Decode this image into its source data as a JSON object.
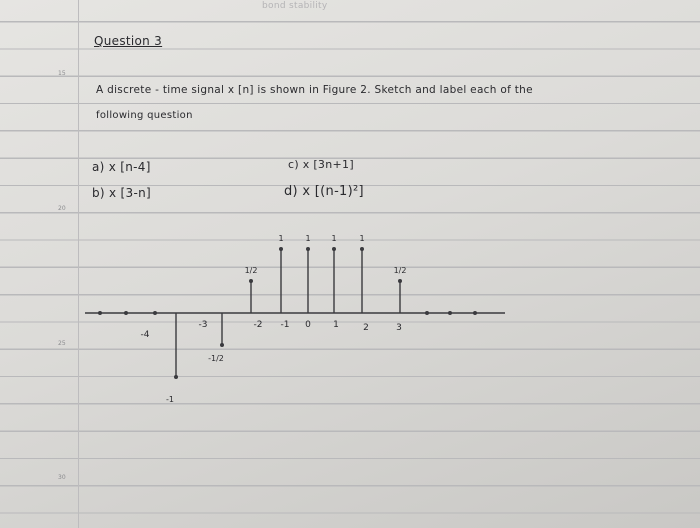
{
  "heading": "Question 3",
  "faint_top": "bond stability",
  "prompt_line1": "A discrete - time signal x [n] is shown in Figure 2. Sketch and label each of the",
  "prompt_line2": "following question",
  "parts": {
    "a": "a) x [n-4]",
    "b": "b) x [3-n]",
    "c": "c) x [3n+1]",
    "d": "d) x [(n-1)²]"
  },
  "margin_numbers": [
    "15",
    "20",
    "25",
    "30"
  ],
  "chart_data": {
    "type": "stem",
    "title": "",
    "n": [
      -7,
      -6,
      -5,
      -4,
      -3,
      -2,
      -1,
      0,
      1,
      2,
      3,
      4,
      5,
      6
    ],
    "values": [
      0,
      0,
      0,
      -1,
      -0.5,
      0.5,
      1,
      1,
      1,
      1,
      0.5,
      0,
      0,
      0
    ],
    "tick_labels": [
      "-4",
      "-3",
      "-2",
      "-1",
      "0",
      "1",
      "2",
      "3"
    ],
    "value_labels": [
      "-1",
      "-1/2",
      "1/2",
      "1",
      "1",
      "1",
      "1",
      "1/2"
    ]
  }
}
